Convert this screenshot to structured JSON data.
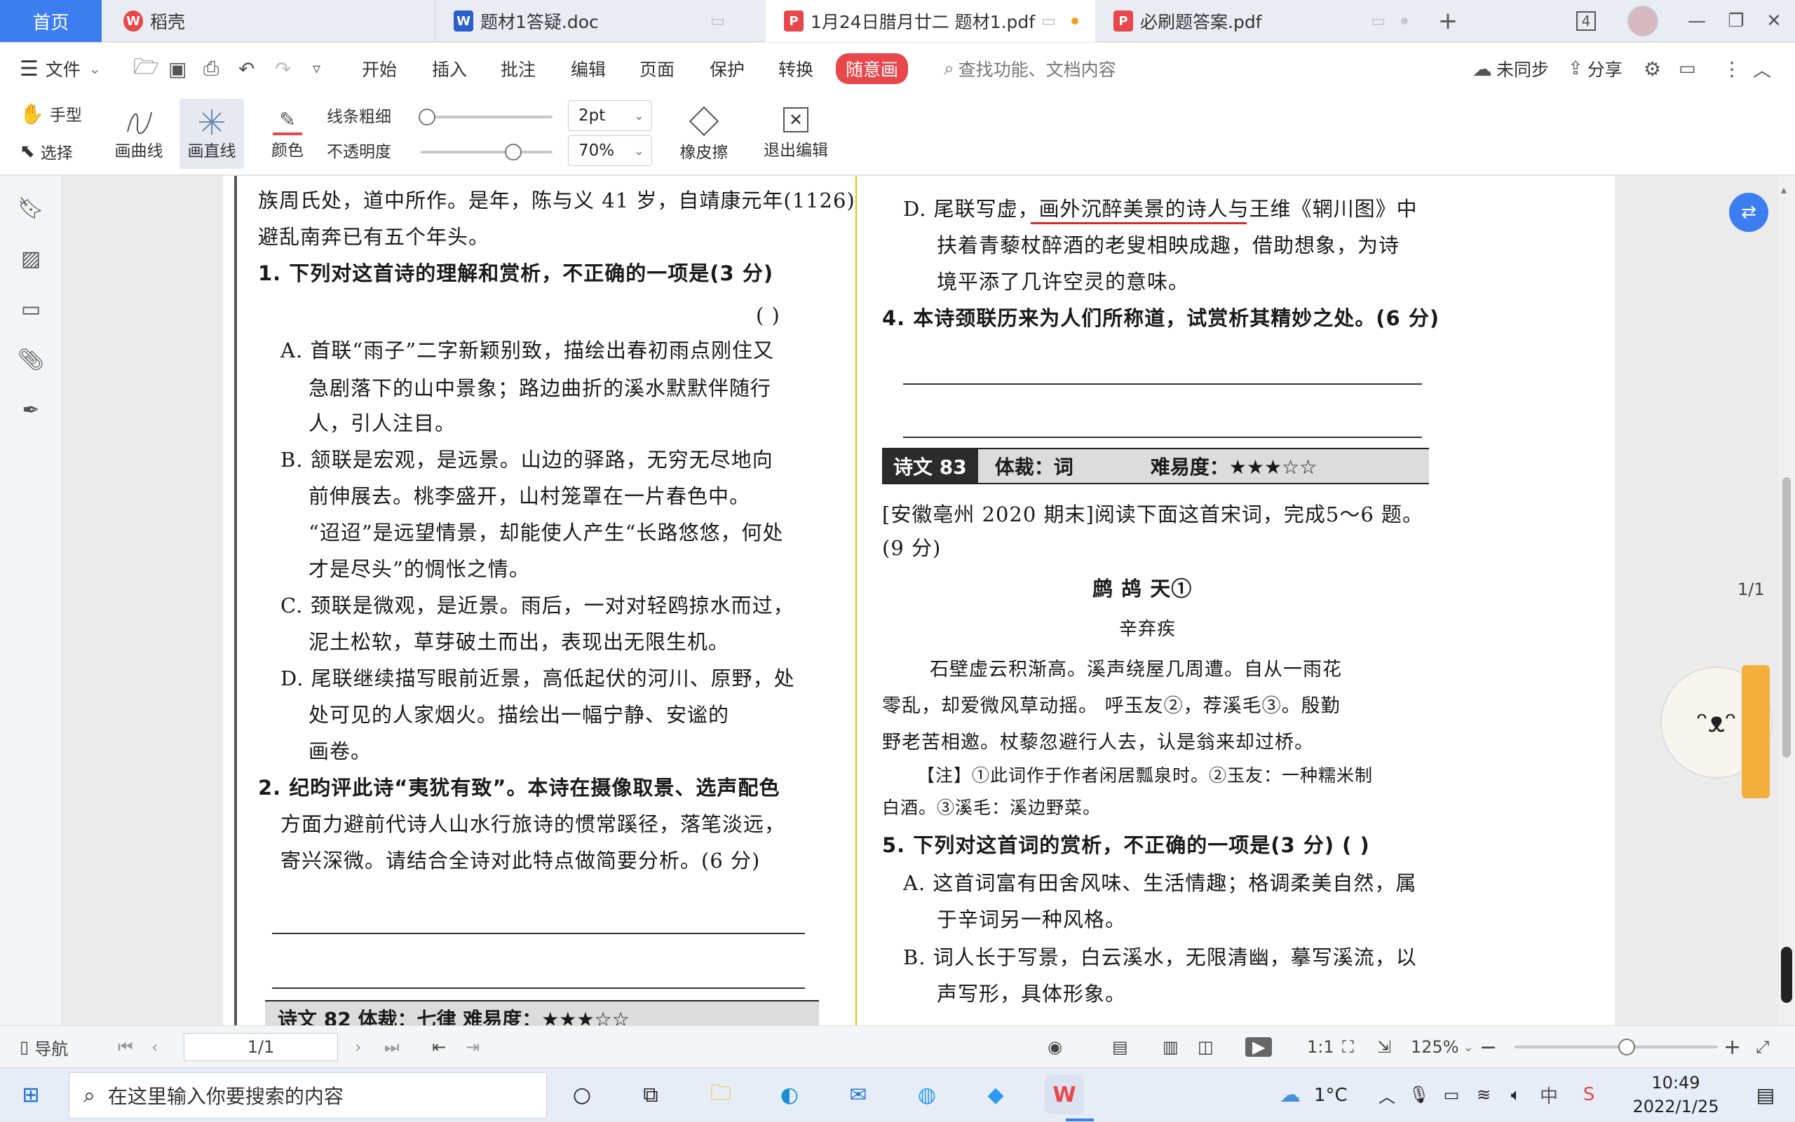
{
  "tabs": {
    "home": "首页",
    "items": [
      {
        "label": "稻壳",
        "color": "#e8474b",
        "glyph": "W"
      },
      {
        "label": "题材1答疑.doc",
        "color": "#2b5fce",
        "glyph": "W"
      },
      {
        "label": "1月24日腊月廿二 题材1.pdf",
        "color": "#e8474b",
        "glyph": "P"
      },
      {
        "label": "必刷题答案.pdf",
        "color": "#e8474b",
        "glyph": "P"
      }
    ],
    "add": "+",
    "count_badge": "4"
  },
  "menu": {
    "file": "文件",
    "items": [
      "开始",
      "插入",
      "批注",
      "编辑",
      "页面",
      "保护",
      "转换"
    ],
    "active": "随意画",
    "search_placeholder": "查找功能、文档内容",
    "sync": "未同步",
    "share": "分享"
  },
  "toolbar": {
    "hand": "手型",
    "select": "选择",
    "curve": "画曲线",
    "line": "画直线",
    "color": "颜色",
    "thickness_label": "线条粗细",
    "thickness_value": "2pt",
    "opacity_label": "不透明度",
    "opacity_value": "70%",
    "eraser": "橡皮擦",
    "exit": "退出编辑",
    "thickness_level": 0.05,
    "opacity_level": 0.7
  },
  "page_indicator": "1/1",
  "left_col": {
    "lines": [
      "族周氏处，道中所作。是年，陈与义 41 岁，自靖康元年(1126)",
      "避乱南奔已有五个年头。"
    ],
    "q1": "1. 下列对这首诗的理解和赏析，不正确的一项是(3 分)",
    "q1_paren": "(    )",
    "optA": [
      "A. 首联“雨子”二字新颖别致，描绘出春初雨点刚住又",
      "急剧落下的山中景象；路边曲折的溪水默默伴随行",
      "人，引人注目。"
    ],
    "optB": [
      "B. 颔联是宏观，是远景。山边的驿路，无穷无尽地向",
      "前伸展去。桃李盛开，山村笼罩在一片春色中。",
      "“迢迢”是远望情景，却能使人产生“长路悠悠，何处",
      "才是尽头”的惆怅之情。"
    ],
    "optC": [
      "C. 颈联是微观，是近景。雨后，一对对轻鸥掠水而过，",
      "泥土松软，草芽破土而出，表现出无限生机。"
    ],
    "optD": [
      "D. 尾联继续描写眼前近景，高低起伏的河川、原野，处",
      "处可见的人家烟火。描绘出一幅宁静、安谧的",
      "画卷。"
    ],
    "q2": [
      "2. 纪昀评此诗“夷犹有致”。本诗在摄像取景、选声配色",
      "方面力避前代诗人山水行旅诗的惯常蹊径，落笔淡远，",
      "寄兴深微。请结合全诗对此特点做简要分析。(6 分)"
    ],
    "bottom_bar": "诗文 82   体裁：七律   难易度：★★★☆☆"
  },
  "right_col": {
    "optD": [
      "D. 尾联写虚，画外沉醉美景的诗人与王维《辋川图》中",
      "扶着青藜杖醉酒的老叟相映成趣，借助想象，为诗",
      "境平添了几许空灵的意味。"
    ],
    "q4": "4. 本诗颈联历来为人们所称道，试赏析其精妙之处。(6 分)",
    "bar_label": "诗文 83",
    "bar_genre": "体裁：词",
    "bar_diff": "难易度：★★★☆☆",
    "intro": [
      "[安徽亳州 2020 期末]阅读下面这首宋词，完成5～6 题。",
      "(9 分)"
    ],
    "poem_title": "鹧 鸪 天①",
    "author": "辛弃疾",
    "poem": [
      "石壁虚云积渐高。溪声绕屋几周遭。自从一雨花",
      "零乱，却爱微风草动摇。    呼玉友②，荐溪毛③。殷勤",
      "野老苦相邀。杖藜忽避行人去，认是翁来却过桥。"
    ],
    "note": [
      "【注】①此词作于作者闲居瓢泉时。②玉友：一种糯米制",
      "白酒。③溪毛：溪边野菜。"
    ],
    "q5": "5. 下列对这首词的赏析，不正确的一项是(3 分)  (    )",
    "q5A": [
      "A. 这首词富有田舍风味、生活情趣；格调柔美自然，属",
      "于辛词另一种风格。"
    ],
    "q5B": [
      "B. 词人长于写景，白云溪水，无限清幽，摹写溪流，以",
      "声写形，具体形象。"
    ]
  },
  "statusbar": {
    "nav": "导航",
    "page": "1/1",
    "zoom": "125%",
    "zoom_level": 0.55
  },
  "taskbar": {
    "search_placeholder": "在这里输入你要搜索的内容",
    "weather": "1°C",
    "ime": "中",
    "time": "10:49",
    "date": "2022/1/25"
  }
}
